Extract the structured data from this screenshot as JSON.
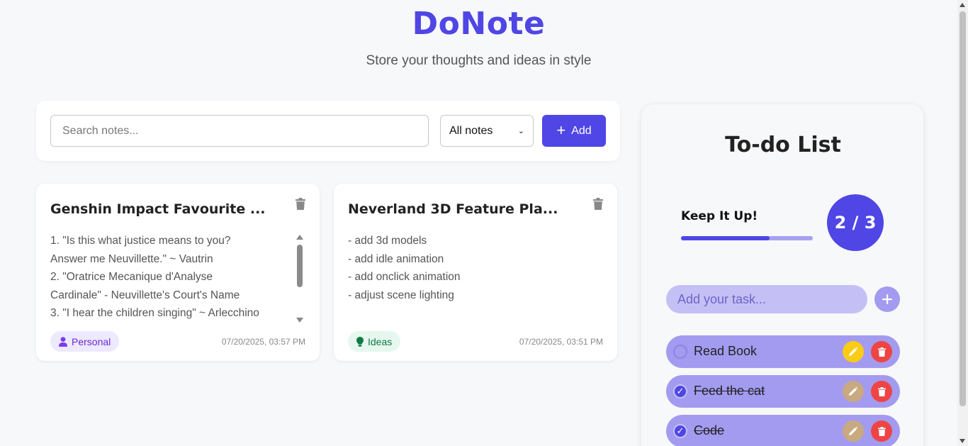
{
  "header": {
    "title": "DoNote",
    "subtitle": "Store your thoughts and ideas in style"
  },
  "toolbar": {
    "search_placeholder": "Search notes...",
    "filter_selected": "All notes",
    "add_label": "Add"
  },
  "notes": [
    {
      "title": "Genshin Impact Favourite ...",
      "lines": [
        "1. \"Is this what justice means to you?",
        "Answer me Neuvillette.\" ~ Vautrin",
        "2. \"Oratrice Mecanique d'Analyse",
        "Cardinale\" - Neuvillette's Court's Name",
        "3. \"I hear the children singing\" ~ Arlecchino"
      ],
      "tag": "Personal",
      "tag_icon": "person-icon",
      "date": "07/20/2025, 03:57 PM"
    },
    {
      "title": "Neverland 3D Feature Pla...",
      "lines": [
        "- add 3d models",
        "- add idle animation",
        "- add onclick animation",
        "- adjust scene lighting"
      ],
      "tag": "Ideas",
      "tag_icon": "lightbulb-icon",
      "date": "07/20/2025, 03:51 PM"
    }
  ],
  "todo": {
    "title": "To-do List",
    "progress_label": "Keep It Up!",
    "done_count": 2,
    "total_count": 3,
    "count_text": "2 / 3",
    "progress_fraction": 0.67,
    "input_placeholder": "Add your task...",
    "tasks": [
      {
        "label": "Read Book",
        "done": false
      },
      {
        "label": "Feed the cat",
        "done": true
      },
      {
        "label": "Code",
        "done": true
      }
    ]
  },
  "colors": {
    "accent": "#4f46e5",
    "task_bg": "#a39bf0",
    "edit": "#facc15",
    "delete": "#ef4444"
  }
}
